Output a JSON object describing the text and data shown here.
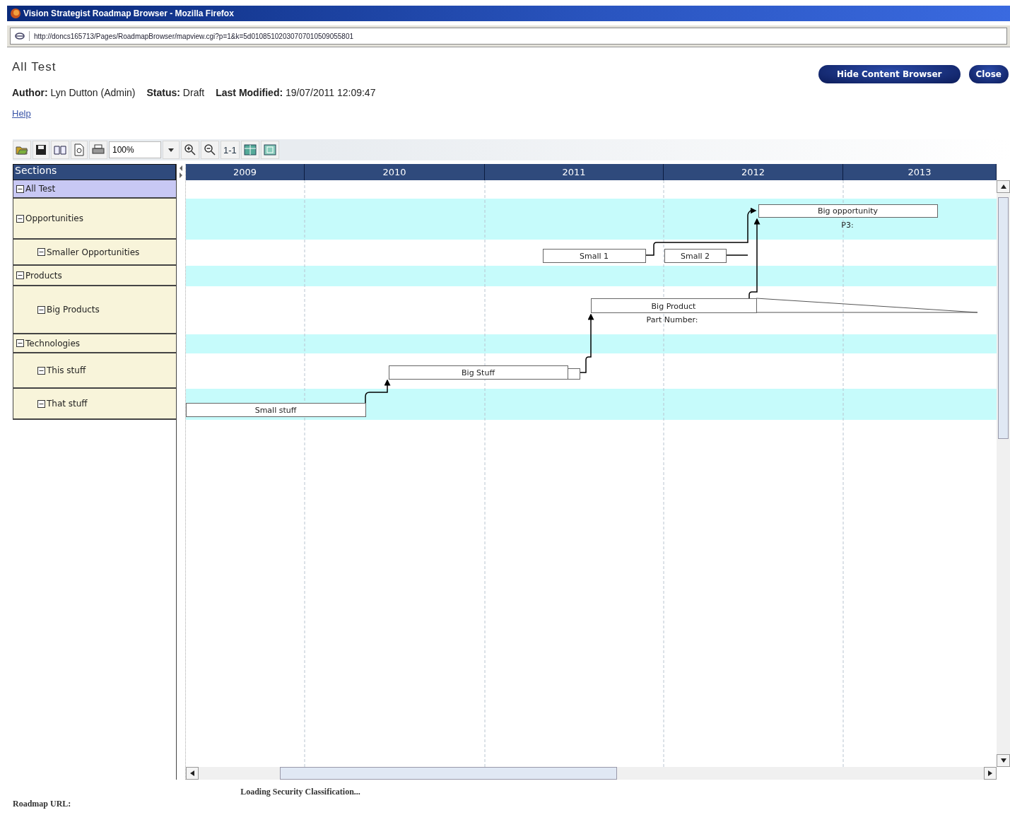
{
  "window": {
    "title": "Vision Strategist Roadmap Browser - Mozilla Firefox"
  },
  "address_bar": {
    "url": "http://doncs165713/Pages/RoadmapBrowser/mapview.cgi?p=1&k=5d01085102030707010509055801"
  },
  "roadmap": {
    "title": "All Test",
    "meta": [
      "**Author:** Lyn Dutton (Admin)",
      "**Status:** Draft",
      "**Last Modified:** 19/07/2011 12:09:47"
    ],
    "help_link": "Help"
  },
  "buttons": [
    "Hide Content Browser",
    "Close"
  ],
  "toolbar": {
    "zoom": "100%",
    "actual_size": "1-1"
  },
  "sections_header": "Sections",
  "sections": [
    {
      "label": "All Test",
      "expanded": true,
      "selected": true,
      "children": [
        {
          "label": "Opportunities",
          "expanded": true,
          "selected": false,
          "children": [
            {
              "label": "Smaller Opportunities",
              "expanded": true,
              "selected": false
            }
          ]
        },
        {
          "label": "Products",
          "expanded": true,
          "selected": false,
          "children": [
            {
              "label": "Big Products",
              "expanded": true,
              "selected": false
            }
          ]
        },
        {
          "label": "Technologies",
          "expanded": true,
          "selected": false,
          "children": [
            {
              "label": "This stuff",
              "expanded": true,
              "selected": false
            },
            {
              "label": "That stuff",
              "expanded": true,
              "selected": false
            }
          ]
        }
      ]
    }
  ],
  "timeline": {
    "years": [
      "2009",
      "2010",
      "2011",
      "2012",
      "2013"
    ]
  },
  "items": [
    {
      "label": "Big opportunity",
      "note": "P3:"
    },
    {
      "label": "Small 1"
    },
    {
      "label": "Small 2"
    },
    {
      "label": "Big Product",
      "note": "Part Number:"
    },
    {
      "label": "Big Stuff"
    },
    {
      "label": "Small stuff"
    }
  ],
  "status": "Loading Security Classification...",
  "footer": {
    "label": "Roadmap URL:"
  }
}
